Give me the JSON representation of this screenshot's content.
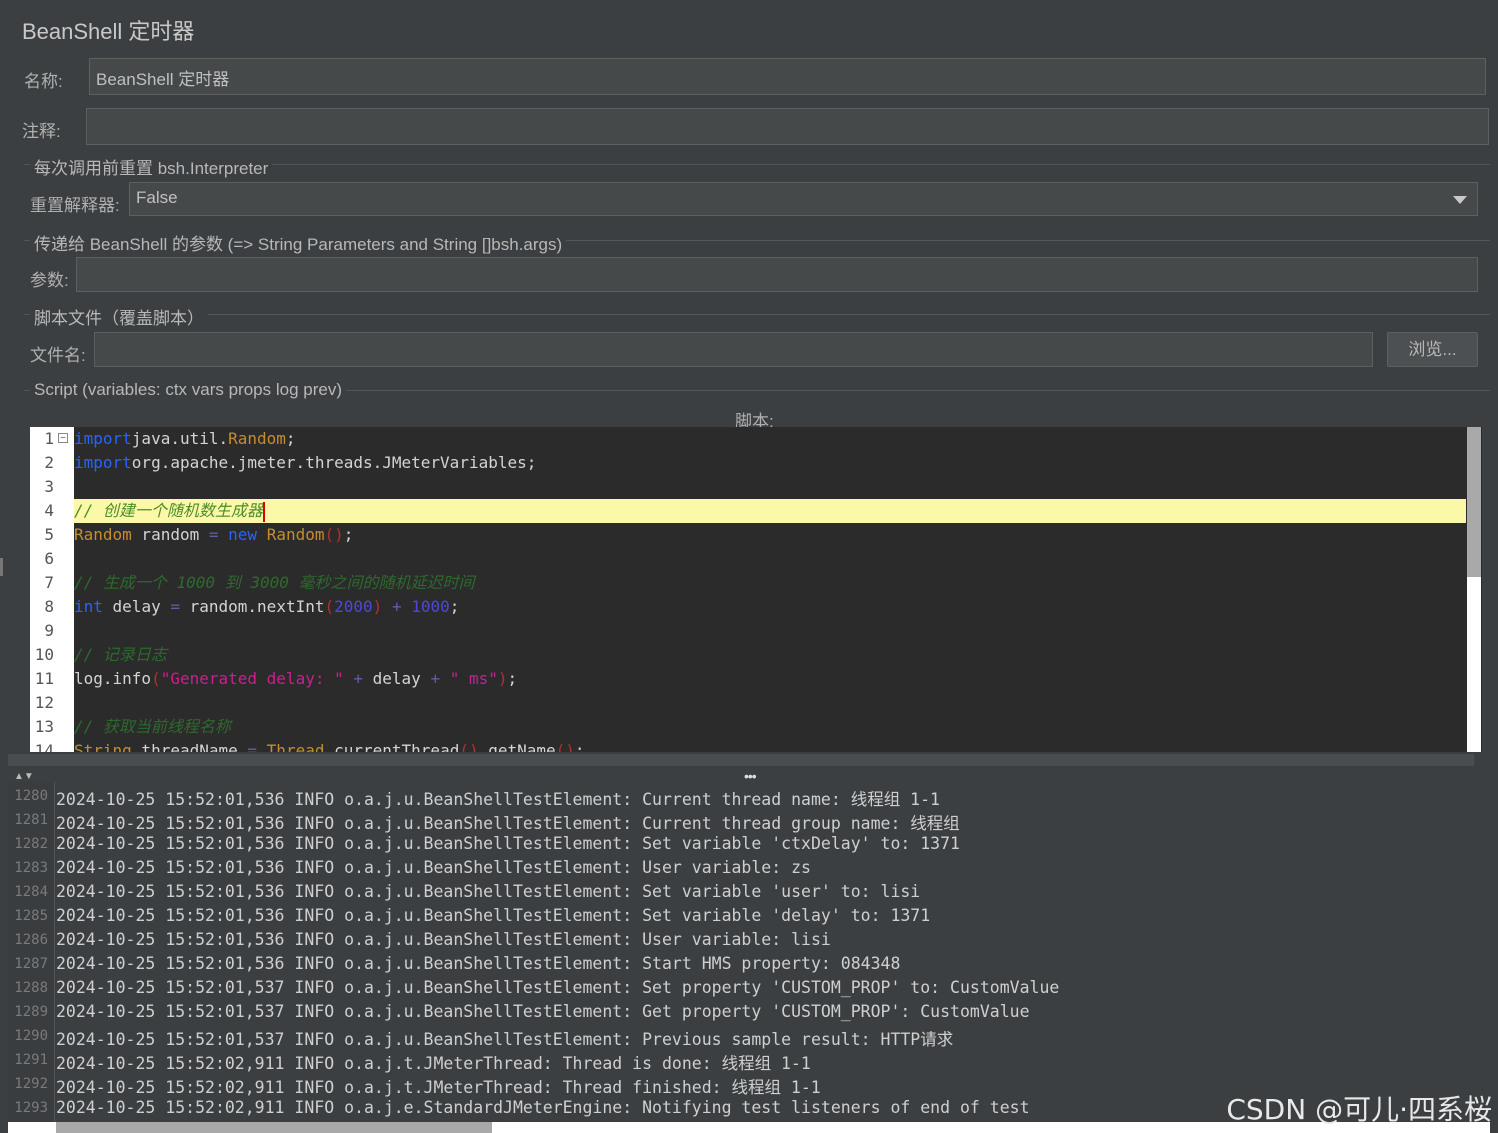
{
  "title": "BeanShell 定时器",
  "name_label": "名称:",
  "name_value": "BeanShell 定时器",
  "comment_label": "注释:",
  "comment_value": "",
  "reset_group": "每次调用前重置 bsh.Interpreter",
  "reset_label": "重置解释器:",
  "reset_value": "False",
  "params_group": "传递给 BeanShell 的参数 (=> String Parameters and String []bsh.args)",
  "params_label": "参数:",
  "params_value": "",
  "file_group": "脚本文件（覆盖脚本）",
  "file_label": "文件名:",
  "file_value": "",
  "browse_label": "浏览...",
  "script_group": "Script (variables: ctx vars props log prev)",
  "script_label": "脚本:",
  "script_lines": [
    {
      "n": "1",
      "tokens": [
        [
          "kw",
          "import"
        ],
        [
          "",
          "java.util."
        ],
        [
          "ty",
          "Random"
        ],
        [
          "",
          ";"
        ]
      ]
    },
    {
      "n": "2",
      "tokens": [
        [
          "kw",
          "import"
        ],
        [
          "",
          "org.apache.jmeter.threads.JMeterVariables;"
        ]
      ]
    },
    {
      "n": "3",
      "tokens": []
    },
    {
      "n": "4",
      "tokens": [
        [
          "cmhl",
          "// 创建一个随机数生成器"
        ]
      ]
    },
    {
      "n": "5",
      "tokens": [
        [
          "ty",
          "Random"
        ],
        [
          "",
          " random "
        ],
        [
          "op",
          "="
        ],
        [
          "",
          " "
        ],
        [
          "kw",
          "new"
        ],
        [
          "",
          " "
        ],
        [
          "ty",
          "Random"
        ],
        [
          "pn",
          "()"
        ],
        [
          "",
          ";"
        ]
      ]
    },
    {
      "n": "6",
      "tokens": []
    },
    {
      "n": "7",
      "tokens": [
        [
          "cm",
          "// 生成一个 1000 到 3000 毫秒之间的随机延迟时间"
        ]
      ]
    },
    {
      "n": "8",
      "tokens": [
        [
          "kw",
          "int"
        ],
        [
          "",
          " delay "
        ],
        [
          "op",
          "="
        ],
        [
          "",
          " random.nextInt"
        ],
        [
          "pn",
          "("
        ],
        [
          "nm",
          "2000"
        ],
        [
          "pn",
          ")"
        ],
        [
          "",
          " "
        ],
        [
          "op",
          "+"
        ],
        [
          "",
          " "
        ],
        [
          "nm",
          "1000"
        ],
        [
          "",
          ";"
        ]
      ]
    },
    {
      "n": "9",
      "tokens": []
    },
    {
      "n": "10",
      "tokens": [
        [
          "cm",
          "// 记录日志"
        ]
      ]
    },
    {
      "n": "11",
      "tokens": [
        [
          "",
          "log.info"
        ],
        [
          "pn",
          "("
        ],
        [
          "st",
          "\"Generated delay: \""
        ],
        [
          "",
          " "
        ],
        [
          "op",
          "+"
        ],
        [
          "",
          " delay "
        ],
        [
          "op",
          "+"
        ],
        [
          "",
          " "
        ],
        [
          "st",
          "\" ms\""
        ],
        [
          "pn",
          ")"
        ],
        [
          "",
          ";"
        ]
      ]
    },
    {
      "n": "12",
      "tokens": []
    },
    {
      "n": "13",
      "tokens": [
        [
          "cm",
          "// 获取当前线程名称"
        ]
      ]
    },
    {
      "n": "14",
      "tokens": [
        [
          "ty",
          "String"
        ],
        [
          "",
          " threadName "
        ],
        [
          "op",
          "="
        ],
        [
          "",
          " "
        ],
        [
          "ty",
          "Thread"
        ],
        [
          "",
          ".currentThread"
        ],
        [
          "pn",
          "()"
        ],
        [
          "",
          ".getName"
        ],
        [
          "pn",
          "()"
        ],
        [
          "",
          ";"
        ]
      ]
    }
  ],
  "log_lines": [
    {
      "n": "1280",
      "text": "2024-10-25 15:52:01,536 INFO o.a.j.u.BeanShellTestElement: Current thread name: 线程组 1-1"
    },
    {
      "n": "1281",
      "text": "2024-10-25 15:52:01,536 INFO o.a.j.u.BeanShellTestElement: Current thread group name: 线程组"
    },
    {
      "n": "1282",
      "text": "2024-10-25 15:52:01,536 INFO o.a.j.u.BeanShellTestElement: Set variable 'ctxDelay' to: 1371"
    },
    {
      "n": "1283",
      "text": "2024-10-25 15:52:01,536 INFO o.a.j.u.BeanShellTestElement: User variable: zs"
    },
    {
      "n": "1284",
      "text": "2024-10-25 15:52:01,536 INFO o.a.j.u.BeanShellTestElement: Set variable 'user' to: lisi"
    },
    {
      "n": "1285",
      "text": "2024-10-25 15:52:01,536 INFO o.a.j.u.BeanShellTestElement: Set variable 'delay' to: 1371"
    },
    {
      "n": "1286",
      "text": "2024-10-25 15:52:01,536 INFO o.a.j.u.BeanShellTestElement: User variable: lisi"
    },
    {
      "n": "1287",
      "text": "2024-10-25 15:52:01,536 INFO o.a.j.u.BeanShellTestElement: Start HMS property: 084348"
    },
    {
      "n": "1288",
      "text": "2024-10-25 15:52:01,537 INFO o.a.j.u.BeanShellTestElement: Set property 'CUSTOM_PROP' to: CustomValue"
    },
    {
      "n": "1289",
      "text": "2024-10-25 15:52:01,537 INFO o.a.j.u.BeanShellTestElement: Get property 'CUSTOM_PROP': CustomValue"
    },
    {
      "n": "1290",
      "text": "2024-10-25 15:52:01,537 INFO o.a.j.u.BeanShellTestElement: Previous sample result: HTTP请求"
    },
    {
      "n": "1291",
      "text": "2024-10-25 15:52:02,911 INFO o.a.j.t.JMeterThread: Thread is done: 线程组 1-1"
    },
    {
      "n": "1292",
      "text": "2024-10-25 15:52:02,911 INFO o.a.j.t.JMeterThread: Thread finished: 线程组 1-1"
    },
    {
      "n": "1293",
      "text": "2024-10-25 15:52:02,911 INFO o.a.j.e.StandardJMeterEngine: Notifying test listeners of end of test"
    }
  ],
  "watermark": "CSDN @可儿·四系桜",
  "icons": {
    "dropdown": "chevron-down-icon",
    "fold": "fold-minus-icon",
    "splitter": "splitter-dots-icon"
  }
}
